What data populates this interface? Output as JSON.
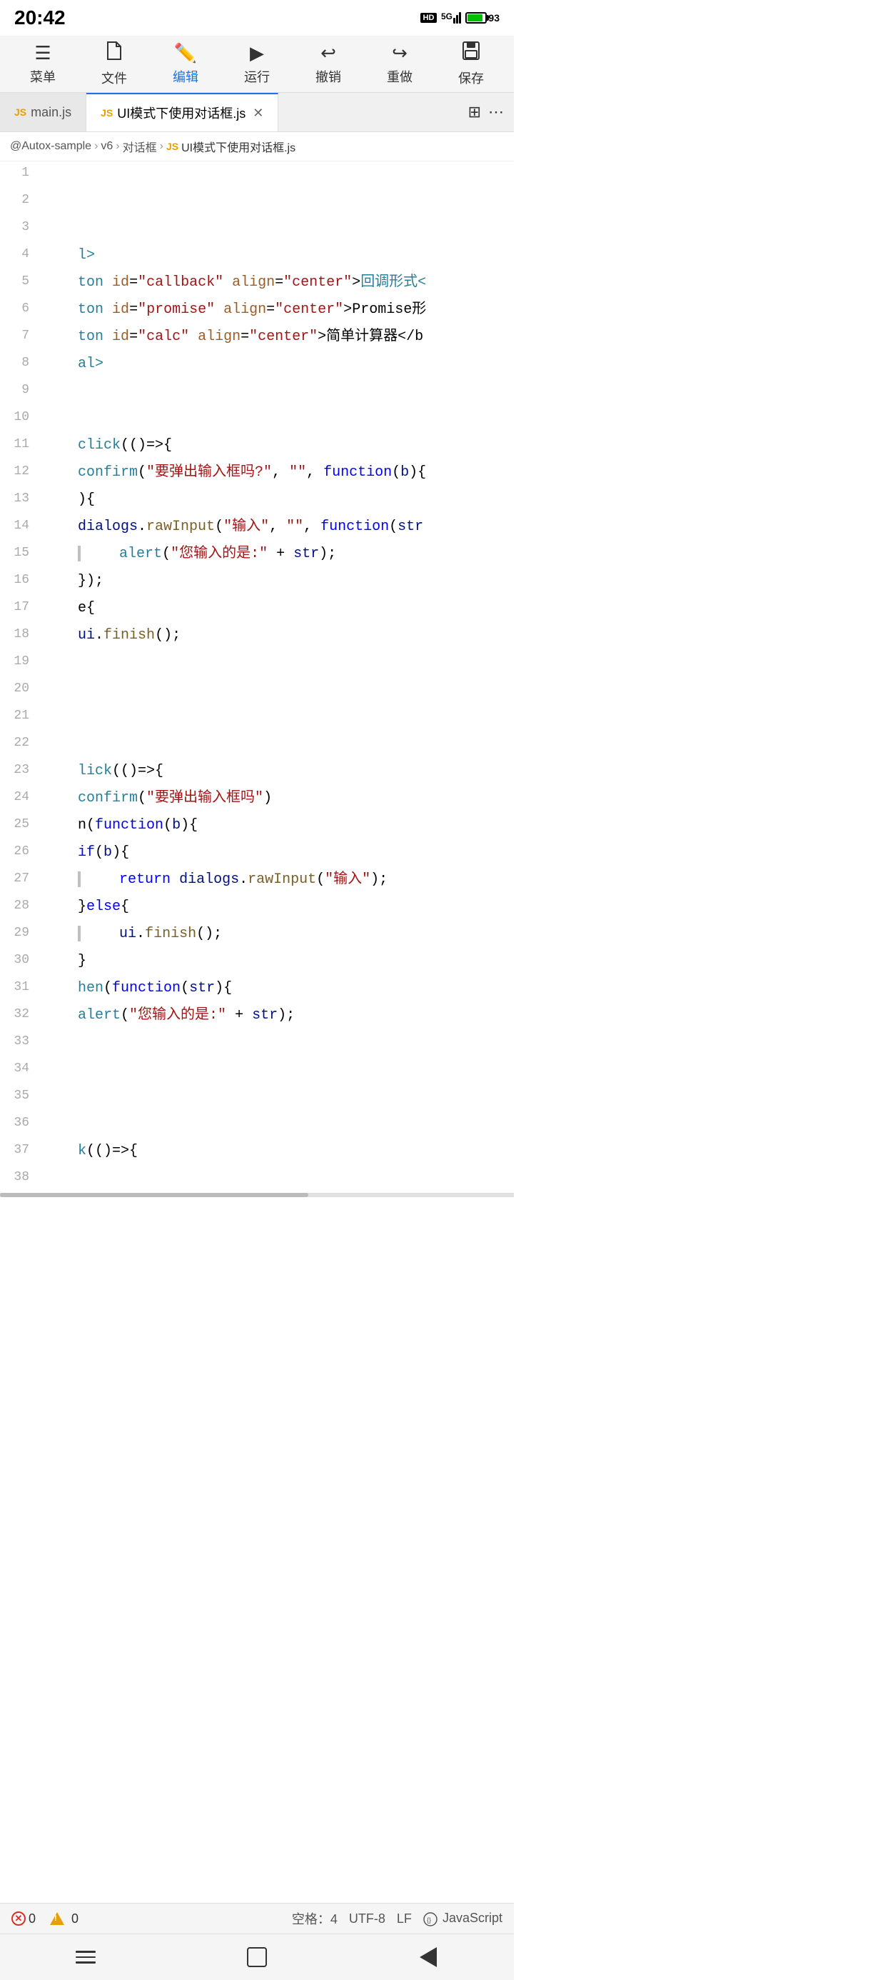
{
  "statusBar": {
    "time": "20:42",
    "hd": "HD",
    "signal": "5G",
    "battery": "93"
  },
  "toolbar": {
    "items": [
      {
        "id": "menu",
        "label": "菜单",
        "icon": "☰"
      },
      {
        "id": "file",
        "label": "文件",
        "icon": "📄"
      },
      {
        "id": "edit",
        "label": "编辑",
        "icon": "✏️"
      },
      {
        "id": "run",
        "label": "运行",
        "icon": "▶"
      },
      {
        "id": "undo",
        "label": "撤销",
        "icon": "↩"
      },
      {
        "id": "redo",
        "label": "重做",
        "icon": "↪"
      },
      {
        "id": "save",
        "label": "保存",
        "icon": "💾"
      }
    ]
  },
  "tabs": [
    {
      "id": "main",
      "label": "main.js",
      "badge": "JS",
      "active": false
    },
    {
      "id": "dialog",
      "label": "UI模式下使用对话框.js",
      "badge": "JS",
      "active": true,
      "closeable": true
    }
  ],
  "breadcrumb": {
    "parts": [
      "@Autox-sample",
      "v6",
      "对话框"
    ],
    "badge": "JS",
    "file": "UI模式下使用对话框.js"
  },
  "code": {
    "lines": [
      {
        "num": 1,
        "content": ""
      },
      {
        "num": 2,
        "content": ""
      },
      {
        "num": 3,
        "content": ""
      },
      {
        "num": 4,
        "content": "    l>"
      },
      {
        "num": 5,
        "content": "    ton id=\"callback\" align=\"center\">回调形式<"
      },
      {
        "num": 6,
        "content": "    ton id=\"promise\" align=\"center\">Promise形"
      },
      {
        "num": 7,
        "content": "    ton id=\"calc\" align=\"center\">简单计算器</b"
      },
      {
        "num": 8,
        "content": "    al>"
      },
      {
        "num": 9,
        "content": ""
      },
      {
        "num": 10,
        "content": ""
      },
      {
        "num": 11,
        "content": "    click(()=>{"
      },
      {
        "num": 12,
        "content": "    confirm(\"要弹出输入框吗?\", \"\", function(b){"
      },
      {
        "num": 13,
        "content": "    ){"
      },
      {
        "num": 14,
        "content": "    dialogs.rawInput(\"输入\", \"\", function(str"
      },
      {
        "num": 15,
        "content": "        alert(\"您输入的是:\" + str);"
      },
      {
        "num": 16,
        "content": "    });"
      },
      {
        "num": 17,
        "content": "    e{"
      },
      {
        "num": 18,
        "content": "    ui.finish();"
      },
      {
        "num": 19,
        "content": ""
      },
      {
        "num": 20,
        "content": ""
      },
      {
        "num": 21,
        "content": ""
      },
      {
        "num": 22,
        "content": ""
      },
      {
        "num": 23,
        "content": "    lick(()=>{"
      },
      {
        "num": 24,
        "content": "    confirm(\"要弹出输入框吗\")"
      },
      {
        "num": 25,
        "content": "    n(function(b){"
      },
      {
        "num": 26,
        "content": "    if(b){"
      },
      {
        "num": 27,
        "content": "        return dialogs.rawInput(\"输入\");"
      },
      {
        "num": 28,
        "content": "    }else{"
      },
      {
        "num": 29,
        "content": "        ui.finish();"
      },
      {
        "num": 30,
        "content": "    }"
      },
      {
        "num": 31,
        "content": "    hen(function(str){"
      },
      {
        "num": 32,
        "content": "    alert(\"您输入的是:\" + str);"
      },
      {
        "num": 33,
        "content": ""
      },
      {
        "num": 34,
        "content": ""
      },
      {
        "num": 35,
        "content": ""
      },
      {
        "num": 36,
        "content": ""
      },
      {
        "num": 37,
        "content": "    k(()=>{"
      }
    ]
  },
  "statusFooter": {
    "errors": "0",
    "warnings": "0",
    "spaces": "空格：4",
    "encoding": "UTF-8",
    "lineEnding": "LF",
    "language": "JavaScript"
  }
}
